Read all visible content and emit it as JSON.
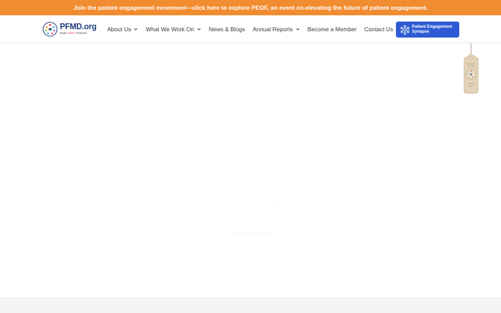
{
  "announcement": {
    "text": "Join the patient engagement movement—click here to explore PEOF, an event co-elevating the future of patient engagement."
  },
  "logo": {
    "name": "PFMD.org",
    "tagline_prefix": "Made ",
    "tagline_accent": "WITH",
    "tagline_suffix": " Patients"
  },
  "nav": {
    "items": [
      {
        "label": "About Us",
        "has_dropdown": true
      },
      {
        "label": "What We Work On",
        "has_dropdown": true
      },
      {
        "label": "News & Blogs",
        "has_dropdown": false
      },
      {
        "label": "Annual Reports",
        "has_dropdown": true
      },
      {
        "label": "Become a Member",
        "has_dropdown": false
      },
      {
        "label": "Contact Us",
        "has_dropdown": false
      }
    ]
  },
  "cta": {
    "line1": "Patient Engagement",
    "line2": "Synapse",
    "icon": "network-icon"
  },
  "hang_tag": {
    "icon": "made-with-patients-tag-icon"
  },
  "colors": {
    "announcement_bg": "#f28c30",
    "brand_blue": "#1f3a7a",
    "cta_bg": "#2d5bd3",
    "footer_bg": "#f4f4f6"
  }
}
